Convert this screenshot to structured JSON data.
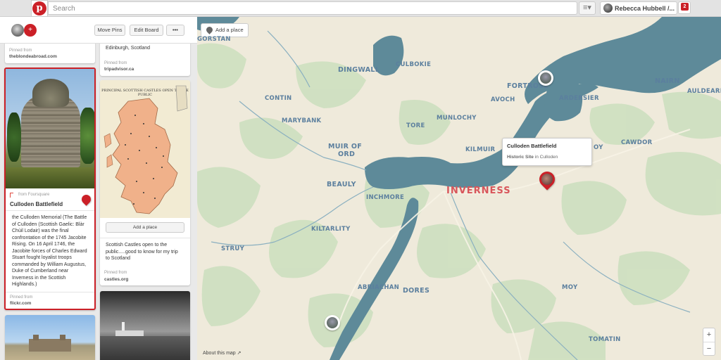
{
  "header": {
    "logo": "p",
    "search_placeholder": "Search",
    "user_name": "Rebecca Hubbell /...",
    "notification_count": "2"
  },
  "board": {
    "move_pins": "Move Pins",
    "edit_board": "Edit Board",
    "more": "•••"
  },
  "pins": {
    "top_left": {
      "pinned_from_label": "Pinned from",
      "source": "theblondeabroad.com"
    },
    "top_right": {
      "desc": "Rosslyn Chapel of The Templars ~ Edinburgh, Scotland",
      "pinned_from_label": "Pinned from",
      "source": "tripadvisor.ca"
    },
    "culloden": {
      "from_label": "from Foursquare",
      "title": "Culloden Battlefield",
      "desc": "the Culloden Memorial (The Battle of Culloden (Scottish Gaelic: Blàr Chùil Lodair) was the final confrontation of the 1745 Jacobite Rising. On 16 April 1746, the Jacobite forces of Charles Edward Stuart fought loyalist troops commanded by William Augustus, Duke of Cumberland near Inverness in the Scottish Highlands.)",
      "pinned_from_label": "Pinned from",
      "source": "flickr.com"
    },
    "castles": {
      "map_title": "PRINCIPAL SCOTTISH CASTLES OPEN TO THE PUBLIC",
      "add_place": "Add a place",
      "desc": "Scottish Castles open to the public.....good to know for my trip to Scotland",
      "pinned_from_label": "Pinned from",
      "source": "castles.org"
    }
  },
  "map": {
    "add_place": "Add a place",
    "about": "About this map",
    "zoom_in": "+",
    "zoom_out": "−",
    "popup_title": "Culloden Battlefield",
    "popup_category": "Historic Site",
    "popup_in": "in",
    "popup_location": "Culloden",
    "places": {
      "gorstan": "GORSTAN",
      "dingwall": "DINGWALL",
      "culbokie": "CULBOKIE",
      "fortrose": "FORTROSE",
      "nairn": "NAIRN",
      "auldearn": "AULDEARN",
      "contin": "CONTIN",
      "avoch": "AVOCH",
      "ardersier": "ARDERSIER",
      "marybank": "MARYBANK",
      "tore": "TORE",
      "munlochy": "MUNLOCHY",
      "muir_of_ord_1": "MUIR OF",
      "muir_of_ord_2": "ORD",
      "kilmuir": "KILMUIR",
      "croy": "OY",
      "cawdor": "CAWDOR",
      "beauly": "BEAULY",
      "inchmore": "INCHMORE",
      "inverness": "INVERNESS",
      "kiltarlity": "KILTARLITY",
      "struy": "STRUY",
      "abriachan": "ABRIACHAN",
      "dores": "DORES",
      "moy": "MOY",
      "tomatin": "TOMATIN"
    }
  }
}
